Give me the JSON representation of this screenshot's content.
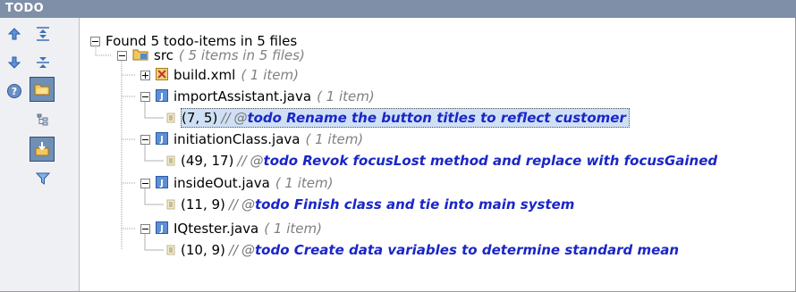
{
  "panel": {
    "title": "TODO"
  },
  "toolbar": {
    "buttons": [
      {
        "name": "previous-item-icon",
        "active": false
      },
      {
        "name": "expand-all-icon",
        "active": false
      },
      {
        "name": "next-item-icon",
        "active": false
      },
      {
        "name": "collapse-all-icon",
        "active": false
      },
      {
        "name": "help-icon",
        "active": false
      },
      {
        "name": "group-by-directory-icon",
        "active": true
      },
      {
        "name": "group-by-module-icon",
        "active": false
      },
      {
        "name": "autoscroll-to-source-icon",
        "active": true
      },
      {
        "name": "filter-icon",
        "active": false
      }
    ]
  },
  "tree": {
    "root": "Found 5 todo-items in 5 files",
    "folder": {
      "name": "src",
      "meta": "( 5 items in 5 files)"
    },
    "files": [
      {
        "name": "build.xml",
        "meta": "( 1 item)",
        "icon": "xml-file-icon",
        "expanded": false
      },
      {
        "name": "importAssistant.java",
        "meta": "( 1 item)",
        "icon": "java-file-icon",
        "expanded": true,
        "todo": {
          "coords": "(7, 5)",
          "slashes": "//",
          "at": "@",
          "text": "todo Rename the button titles to reflect customer",
          "selected": true
        }
      },
      {
        "name": "initiationClass.java",
        "meta": "( 1 item)",
        "icon": "java-file-icon",
        "expanded": true,
        "todo": {
          "coords": "(49, 17)",
          "slashes": "//",
          "at": "@",
          "text": "todo Revok focusLost method and replace with focusGained",
          "selected": false
        }
      },
      {
        "name": "insideOut.java",
        "meta": "( 1 item)",
        "icon": "java-file-icon",
        "expanded": true,
        "todo": {
          "coords": "(11, 9)",
          "slashes": "//",
          "at": "@",
          "text": "todo Finish class and tie into main system",
          "selected": false
        }
      },
      {
        "name": "IQtester.java",
        "meta": "( 1 item)",
        "icon": "java-file-icon",
        "expanded": true,
        "todo": {
          "coords": "(10, 9)",
          "slashes": "//",
          "at": "@",
          "text": "todo Create data variables to determine standard mean",
          "selected": false
        }
      }
    ]
  },
  "colors": {
    "titlebar": "#7f8fa8",
    "todo_text": "#1a26c7",
    "selection": "#cfe0f5",
    "active_button": "#6f8fb6"
  }
}
